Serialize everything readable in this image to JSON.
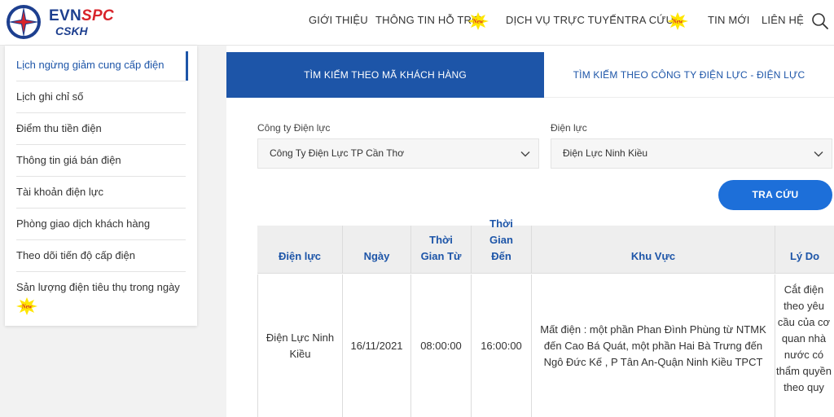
{
  "brand": {
    "name_main": "EVN",
    "name_accent": "SPC",
    "subtitle": "CSKH"
  },
  "nav": {
    "items": [
      {
        "label": "GIỚI THIỆU",
        "new": false
      },
      {
        "label": "THÔNG TIN HỖ TRỢ",
        "new": true
      },
      {
        "label": "DỊCH VỤ TRỰC TUYẾN",
        "new": false
      },
      {
        "label": "TRA CỨU",
        "new": true
      },
      {
        "label": "TIN MỚI",
        "new": false
      },
      {
        "label": "LIÊN HỆ",
        "new": false
      }
    ],
    "new_badge_text": "New"
  },
  "sidebar": {
    "items": [
      {
        "label": "Lịch ngừng giảm cung cấp điện",
        "active": true
      },
      {
        "label": "Lịch ghi chỉ số"
      },
      {
        "label": "Điểm thu tiền điện"
      },
      {
        "label": "Thông tin giá bán điện"
      },
      {
        "label": "Tài khoản điện lực"
      },
      {
        "label": "Phòng giao dịch khách hàng"
      },
      {
        "label": "Theo dõi tiến độ cấp điện"
      },
      {
        "label": "Sản lượng điện tiêu thụ trong ngày",
        "new": true
      }
    ]
  },
  "tabs": [
    {
      "label": "TÌM KIẾM THEO MÃ KHÁCH HÀNG",
      "active": true
    },
    {
      "label": "TÌM KIẾM THEO CÔNG TY ĐIỆN LỰC - ĐIỆN LỰC",
      "active": false
    }
  ],
  "form": {
    "company_label": "Công ty Điện lực",
    "company_value": "Công Ty Điện Lực TP Cần Thơ",
    "branch_label": "Điện lực",
    "branch_value": "Điện Lực Ninh Kiều",
    "search_button": "TRA CỨU"
  },
  "table": {
    "headers": [
      "Điện lực",
      "Ngày",
      "Thời Gian Từ",
      "Thời Gian Đến",
      "Khu Vực",
      "Lý Do"
    ],
    "rows": [
      {
        "branch": "Điện Lực Ninh Kiều",
        "date": "16/11/2021",
        "from": "08:00:00",
        "to": "16:00:00",
        "area": "Mất điện : một phần Phan Đình Phùng từ NTMK đến Cao Bá Quát, một phần Hai Bà Trưng đến Ngô Đức Kế , P Tân An-Quận Ninh Kiều TPCT",
        "reason": "Cắt điện theo yêu cầu của cơ quan nhà nước có thẩm quyền theo quy"
      }
    ]
  },
  "colors": {
    "primary": "#1d55a8",
    "button": "#1d6fd9",
    "brand_red": "#d8232a",
    "badge": "#ffe600"
  }
}
